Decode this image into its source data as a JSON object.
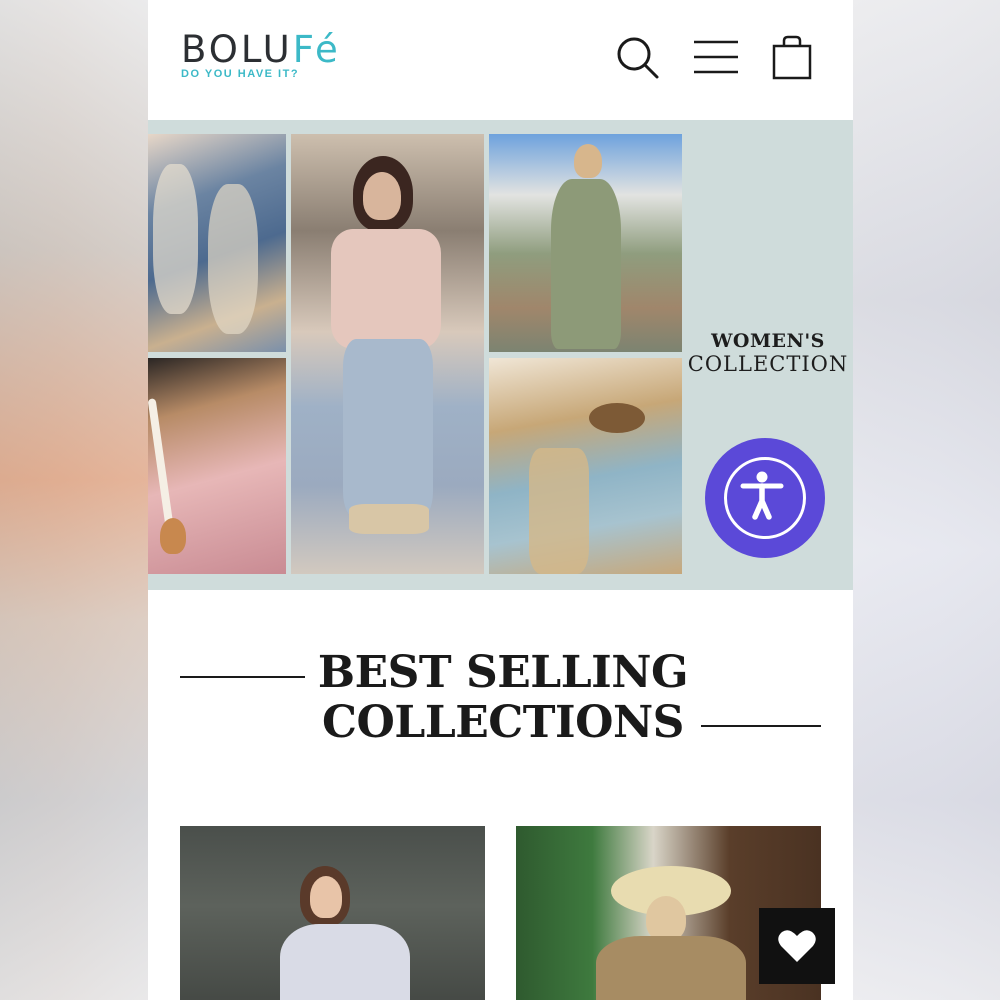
{
  "brand": {
    "name_main": "BOLU",
    "name_accent": "Fé",
    "tagline": "DO YOU HAVE IT?",
    "accent_color": "#3cb9c7"
  },
  "header": {
    "icons": [
      "search-icon",
      "menu-icon",
      "shopping-bag-icon"
    ]
  },
  "hero": {
    "title_line1": "WOMEN'S",
    "title_line2": "COLLECTION"
  },
  "accessibility": {
    "icon": "accessibility-icon",
    "color": "#5b49d8"
  },
  "section": {
    "title_line1": "BEST SELLING",
    "title_line2": "COLLECTIONS"
  },
  "floating": {
    "wishlist_icon": "heart-icon"
  }
}
